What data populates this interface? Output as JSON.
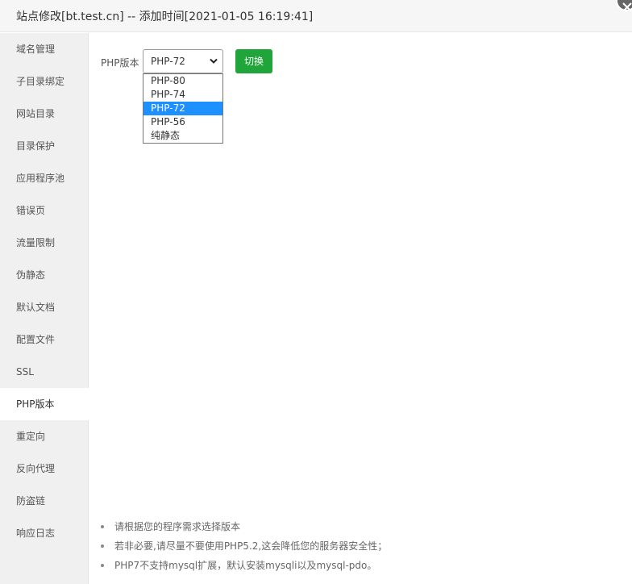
{
  "window": {
    "title": "站点修改[bt.test.cn] -- 添加时间[2021-01-05 16:19:41]",
    "close_icon": "close-icon"
  },
  "sidebar": {
    "items": [
      {
        "label": "域名管理"
      },
      {
        "label": "子目录绑定"
      },
      {
        "label": "网站目录"
      },
      {
        "label": "目录保护"
      },
      {
        "label": "应用程序池"
      },
      {
        "label": "错误页"
      },
      {
        "label": "流量限制"
      },
      {
        "label": "伪静态"
      },
      {
        "label": "默认文档"
      },
      {
        "label": "配置文件"
      },
      {
        "label": "SSL"
      },
      {
        "label": "PHP版本",
        "active": true
      },
      {
        "label": "重定向"
      },
      {
        "label": "反向代理"
      },
      {
        "label": "防盗链"
      },
      {
        "label": "响应日志"
      }
    ]
  },
  "php": {
    "label": "PHP版本",
    "selected": "PHP-72",
    "options": [
      "PHP-80",
      "PHP-74",
      "PHP-72",
      "PHP-56",
      "纯静态"
    ],
    "highlighted_index": 2,
    "switch_label": "切换"
  },
  "tips": [
    "请根据您的程序需求选择版本",
    "若非必要,请尽量不要使用PHP5.2,这会降低您的服务器安全性；",
    "PHP7不支持mysql扩展，默认安装mysqli以及mysql-pdo。"
  ],
  "colors": {
    "accent_green": "#20a53a",
    "highlight_blue": "#1e90ff",
    "sidebar_bg": "#f0f0f0"
  }
}
